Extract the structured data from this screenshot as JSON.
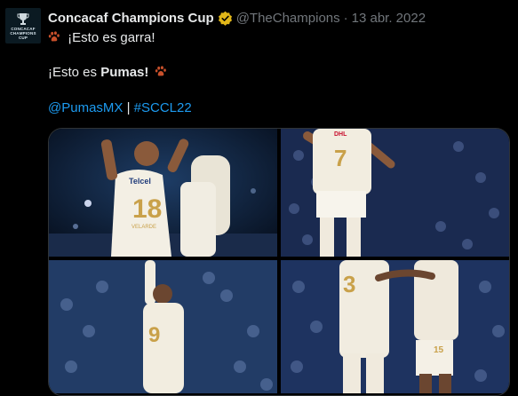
{
  "tweet": {
    "author_name": "Concacaf Champions Cup",
    "author_handle": "@TheChampions",
    "separator": "·",
    "date": "13 abr. 2022",
    "line1": "¡Esto es garra!",
    "line2_prefix": "¡Esto es ",
    "line2_bold": "Pumas!",
    "mention": "@PumasMX",
    "pipe": " | ",
    "hashtag": "#SCCL22"
  },
  "avatar": {
    "logo_text_1": "CONCACAF",
    "logo_text_2": "CHAMPIONS",
    "logo_text_3": "CUP"
  },
  "media": {
    "photos": [
      {
        "jersey_number": "18",
        "sponsor": "Telcel",
        "name_on_back": "VELARDE"
      },
      {
        "jersey_number": "7",
        "sponsor": "DHL"
      },
      {
        "jersey_number": "9",
        "sponsor": ""
      },
      {
        "jersey_number": "3",
        "jersey_number_2": "15",
        "sponsor": ""
      }
    ]
  },
  "colors": {
    "link": "#1d9bf0",
    "verified": "#e2b719",
    "paw": "#c8502b",
    "jersey_gold": "#c9a14a"
  }
}
